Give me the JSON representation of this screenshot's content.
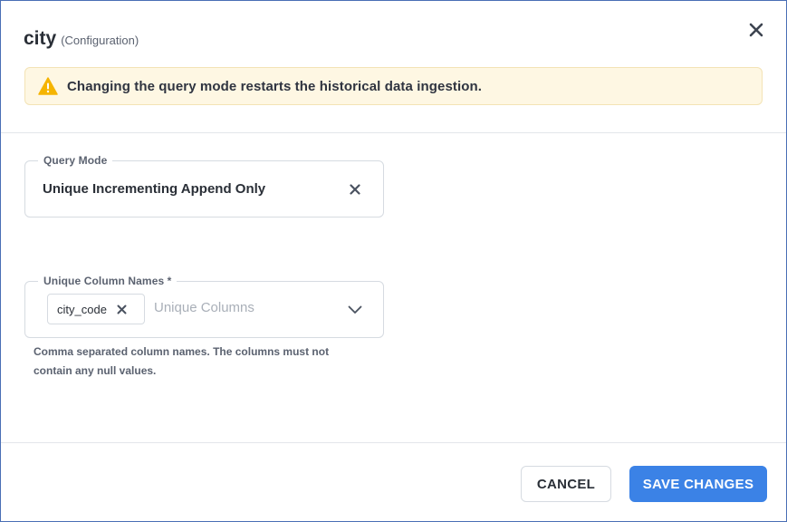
{
  "dialog": {
    "title": "city",
    "subtitle": "(Configuration)",
    "close_icon": "close-icon"
  },
  "alert": {
    "icon": "warning-triangle-icon",
    "text": "Changing the query mode restarts the historical data ingestion.",
    "accent": "#f5b400"
  },
  "query_mode": {
    "label": "Query Mode",
    "value": "Unique Incrementing Append Only",
    "clear_icon": "close-icon"
  },
  "unique_columns": {
    "label": "Unique Column Names *",
    "chips": [
      {
        "label": "city_code"
      }
    ],
    "placeholder": "Unique Columns",
    "helper": "Comma separated column names. The columns must not contain any null values."
  },
  "footer": {
    "cancel_label": "CANCEL",
    "save_label": "SAVE CHANGES",
    "primary_color": "#3b82e6"
  }
}
